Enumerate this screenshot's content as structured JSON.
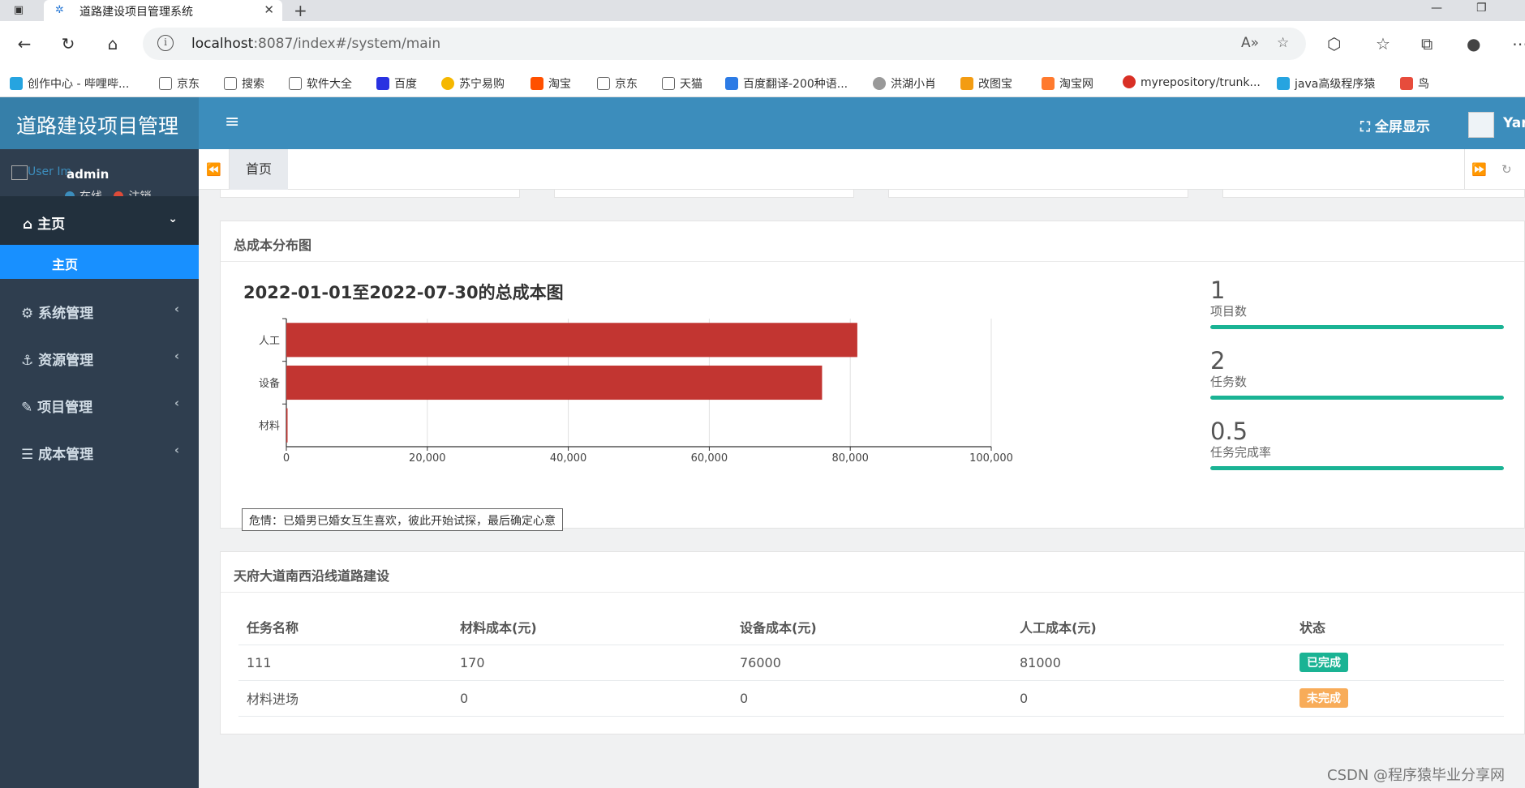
{
  "browser": {
    "tab_title": "道路建设项目管理系统",
    "url_host": "localhost",
    "url_rest": ":8087/index#/system/main",
    "bookmarks": [
      "创作中心 - 哔哩哔...",
      "京东",
      "搜索",
      "软件大全",
      "百度",
      "苏宁易购",
      "淘宝",
      "京东",
      "天猫",
      "百度翻译-200种语...",
      "洪湖小肖",
      "改图宝",
      "淘宝网",
      "myrepository/trunk...",
      "java高级程序猿",
      "鸟"
    ]
  },
  "app": {
    "logo": "道路建设项目管理",
    "fullscreen_label": "全屏显示",
    "user_short": "Yar"
  },
  "sidebar": {
    "user_img_alt": "User Im",
    "user_name": "admin",
    "status_online": "在线",
    "status_logout": "注销",
    "main_menu": "主页",
    "main_sub": "主页",
    "items": [
      "系统管理",
      "资源管理",
      "项目管理",
      "成本管理"
    ]
  },
  "tabs": {
    "home": "首页"
  },
  "cost_panel": {
    "title": "总成本分布图",
    "chart_heading": "2022-01-01至2022-07-30的总成本图",
    "tooltip": "危情：已婚男已婚女互生喜欢，彼此开始试探，最后确定心意"
  },
  "chart_data": {
    "type": "bar",
    "orientation": "horizontal",
    "categories": [
      "人工",
      "设备",
      "材料"
    ],
    "values": [
      81000,
      76000,
      170
    ],
    "xlim": [
      0,
      100000
    ],
    "x_ticks": [
      "0",
      "20,000",
      "40,000",
      "60,000",
      "80,000",
      "100,000"
    ],
    "grid": true,
    "color": "#c23531"
  },
  "kpis": [
    {
      "value": "1",
      "label": "项目数",
      "progress": 1.0
    },
    {
      "value": "2",
      "label": "任务数",
      "progress": 1.0
    },
    {
      "value": "0.5",
      "label": "任务完成率",
      "progress": 1.0
    }
  ],
  "task_panel": {
    "title": "天府大道南西沿线道路建设",
    "columns": [
      "任务名称",
      "材料成本(元)",
      "设备成本(元)",
      "人工成本(元)",
      "状态"
    ],
    "rows": [
      {
        "name": "111",
        "material": "170",
        "equipment": "76000",
        "labor": "81000",
        "status": "已完成",
        "status_color": "#1ab394"
      },
      {
        "name": "材料进场",
        "material": "0",
        "equipment": "0",
        "labor": "0",
        "status": "未完成",
        "status_color": "#f8ac59"
      }
    ]
  },
  "watermark": "CSDN @程序猿毕业分享网"
}
